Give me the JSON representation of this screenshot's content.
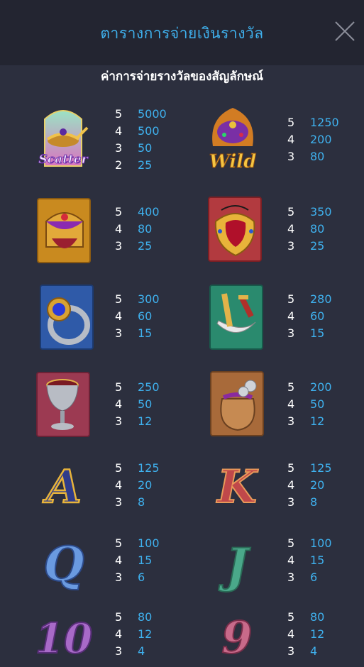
{
  "header": {
    "title": "ตารางการจ่ายเงินรางวัล"
  },
  "subtitle": "ค่าการจ่ายรางวัลของสัญลักษณ์",
  "symbols": [
    {
      "name": "scatter",
      "label": "Scatter",
      "pays": [
        {
          "count": "5",
          "amount": "5000"
        },
        {
          "count": "4",
          "amount": "500"
        },
        {
          "count": "3",
          "amount": "50"
        },
        {
          "count": "2",
          "amount": "25"
        }
      ]
    },
    {
      "name": "wild",
      "label": "Wild",
      "pays": [
        {
          "count": "5",
          "amount": "1250"
        },
        {
          "count": "4",
          "amount": "200"
        },
        {
          "count": "3",
          "amount": "80"
        }
      ]
    },
    {
      "name": "crown",
      "pays": [
        {
          "count": "5",
          "amount": "400"
        },
        {
          "count": "4",
          "amount": "80"
        },
        {
          "count": "3",
          "amount": "25"
        }
      ]
    },
    {
      "name": "amulet",
      "pays": [
        {
          "count": "5",
          "amount": "350"
        },
        {
          "count": "4",
          "amount": "80"
        },
        {
          "count": "3",
          "amount": "25"
        }
      ]
    },
    {
      "name": "ring",
      "pays": [
        {
          "count": "5",
          "amount": "300"
        },
        {
          "count": "4",
          "amount": "60"
        },
        {
          "count": "3",
          "amount": "15"
        }
      ]
    },
    {
      "name": "dagger",
      "pays": [
        {
          "count": "5",
          "amount": "280"
        },
        {
          "count": "4",
          "amount": "60"
        },
        {
          "count": "3",
          "amount": "15"
        }
      ]
    },
    {
      "name": "goblet",
      "pays": [
        {
          "count": "5",
          "amount": "250"
        },
        {
          "count": "4",
          "amount": "50"
        },
        {
          "count": "3",
          "amount": "12"
        }
      ]
    },
    {
      "name": "coin-bag",
      "pays": [
        {
          "count": "5",
          "amount": "200"
        },
        {
          "count": "4",
          "amount": "50"
        },
        {
          "count": "3",
          "amount": "12"
        }
      ]
    },
    {
      "name": "letter-a",
      "label": "A",
      "pays": [
        {
          "count": "5",
          "amount": "125"
        },
        {
          "count": "4",
          "amount": "20"
        },
        {
          "count": "3",
          "amount": "8"
        }
      ]
    },
    {
      "name": "letter-k",
      "label": "K",
      "pays": [
        {
          "count": "5",
          "amount": "125"
        },
        {
          "count": "4",
          "amount": "20"
        },
        {
          "count": "3",
          "amount": "8"
        }
      ]
    },
    {
      "name": "letter-q",
      "label": "Q",
      "pays": [
        {
          "count": "5",
          "amount": "100"
        },
        {
          "count": "4",
          "amount": "15"
        },
        {
          "count": "3",
          "amount": "6"
        }
      ]
    },
    {
      "name": "letter-j",
      "label": "J",
      "pays": [
        {
          "count": "5",
          "amount": "100"
        },
        {
          "count": "4",
          "amount": "15"
        },
        {
          "count": "3",
          "amount": "6"
        }
      ]
    },
    {
      "name": "number-10",
      "label": "10",
      "pays": [
        {
          "count": "5",
          "amount": "80"
        },
        {
          "count": "4",
          "amount": "12"
        },
        {
          "count": "3",
          "amount": "4"
        }
      ]
    },
    {
      "name": "number-9",
      "label": "9",
      "pays": [
        {
          "count": "5",
          "amount": "80"
        },
        {
          "count": "4",
          "amount": "12"
        },
        {
          "count": "3",
          "amount": "4"
        }
      ]
    }
  ]
}
